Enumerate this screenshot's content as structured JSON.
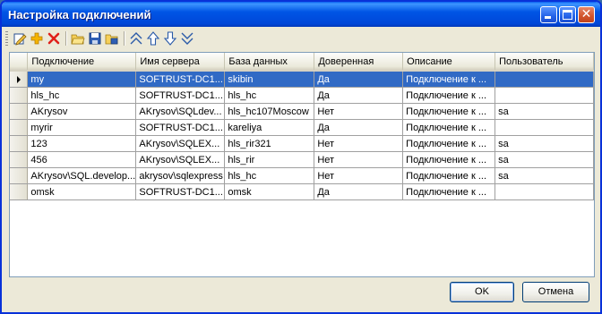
{
  "window": {
    "title": "Настройка подключений"
  },
  "toolbar": {
    "tools": [
      "edit-icon",
      "add-icon",
      "delete-icon",
      "open-folder-icon",
      "save-icon",
      "folder-save-icon",
      "move-top-icon",
      "move-up-icon",
      "move-down-icon",
      "move-bottom-icon"
    ]
  },
  "grid": {
    "columns": [
      "Подключение",
      "Имя сервера",
      "База данных",
      "Доверенная",
      "Описание",
      "Пользователь"
    ],
    "rows": [
      [
        "my",
        "SOFTRUST-DC1...",
        "skibin",
        "Да",
        "Подключение к ...",
        ""
      ],
      [
        "hls_hc",
        "SOFTRUST-DC1...",
        "hls_hc",
        "Да",
        "Подключение к ...",
        ""
      ],
      [
        "AKrysov",
        "AKrysov\\SQLdev...",
        "hls_hc107Moscow",
        "Нет",
        "Подключение к ...",
        "sa"
      ],
      [
        "myrir",
        "SOFTRUST-DC1...",
        "kareliya",
        "Да",
        "Подключение к ...",
        ""
      ],
      [
        "123",
        "AKrysov\\SQLEX...",
        "hls_rir321",
        "Нет",
        "Подключение к ...",
        "sa"
      ],
      [
        "456",
        "AKrysov\\SQLEX...",
        "hls_rir",
        "Нет",
        "Подключение к ...",
        "sa"
      ],
      [
        "AKrysov\\SQL.develop...",
        "akrysov\\sqlexpress",
        "hls_hc",
        "Нет",
        "Подключение к ...",
        "sa"
      ],
      [
        "omsk",
        "SOFTRUST-DC1...",
        "omsk",
        "Да",
        "Подключение к ...",
        ""
      ]
    ],
    "selected_row": 0
  },
  "buttons": {
    "ok": "OK",
    "cancel": "Отмена"
  },
  "colors": {
    "selection": "#316ac5",
    "titlebar": "#0055e5"
  }
}
